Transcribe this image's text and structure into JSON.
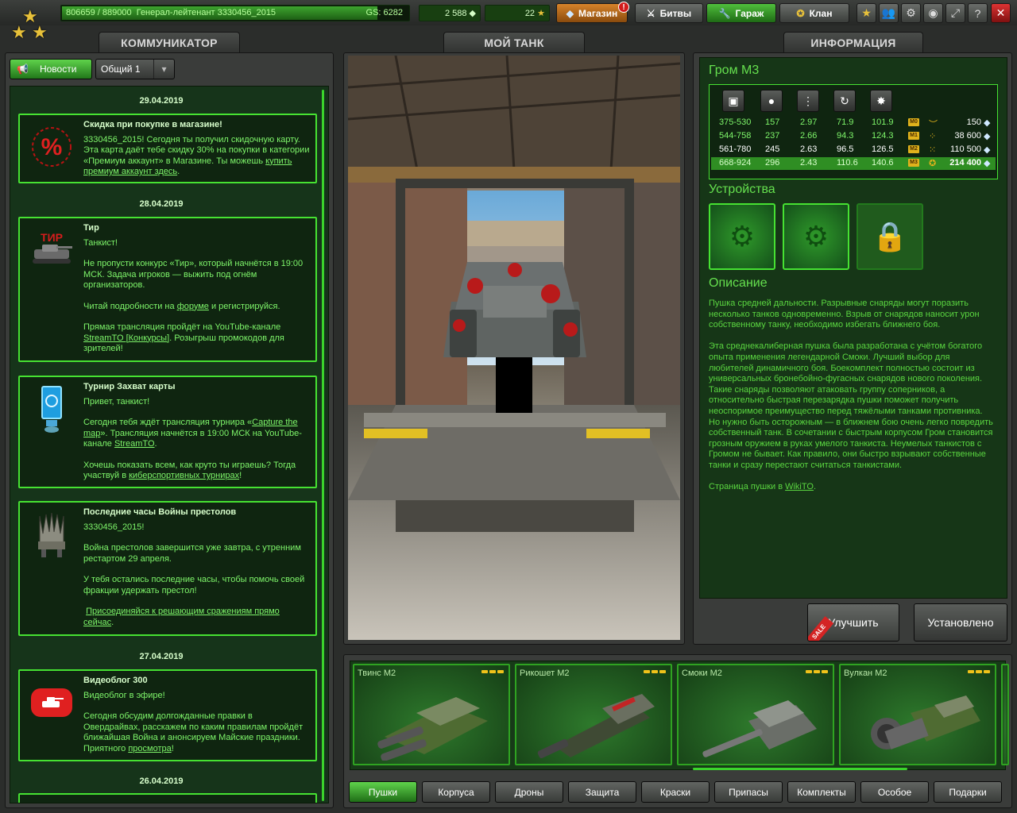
{
  "top": {
    "rank_progress": "806659 / 889000",
    "rank_progress_fraction": 0.907,
    "rank_name": "Генерал-лейтенант 3330456_2015",
    "gs": "GS: 6282",
    "crystals": "2 588",
    "stars": "22",
    "shop_label": "Магазин",
    "shop_badge": "!",
    "battles_label": "Битвы",
    "garage_label": "Гараж",
    "clan_label": "Клан"
  },
  "tabs": {
    "communicator": "КОММУНИКАТОР",
    "my_tank": "МОЙ ТАНК",
    "info": "ИНФОРМАЦИЯ"
  },
  "communicator": {
    "news_button": "Новости",
    "channel_select": "Общий 1",
    "feed": [
      {
        "type": "date",
        "text": "29.04.2019"
      },
      {
        "type": "card",
        "icon": "discount-percent-icon",
        "title": "Скидка при покупке в магазине!",
        "body": "3330456_2015! Сегодня ты получил скидочную карту. Эта карта даёт тебе скидку 30% на покупки в категории «Премиум аккаунт» в Магазине. Ты можешь ",
        "link": "купить премиум аккаунт здесь",
        "tail": "."
      },
      {
        "type": "date",
        "text": "28.04.2019"
      },
      {
        "type": "card",
        "icon": "shooting-range-icon",
        "title": "Тир",
        "p1": "Танкист!",
        "p2a": "Не пропусти конкурс «Тир», который начнётся в 19:00 МСК. Задача игроков — выжить под огнём организаторов.",
        "p3a": "Читай подробности на ",
        "p3link": "форуме",
        "p3b": " и регистрируйся.",
        "p4a": "Прямая трансляция пройдёт на YouTube-канале ",
        "p4link": "StreamTO [Конкурсы]",
        "p4b": ". Розыгрыш промокодов для зрителей!"
      },
      {
        "type": "card",
        "icon": "capture-flag-icon",
        "title": "Турнир Захват карты",
        "p1": "Привет, танкист!",
        "p2a": " Сегодня тебя ждёт трансляция турнира «",
        "p2link": "Capture the map",
        "p2b": "». Трансляция начнётся в 19:00 МСК на YouTube-канале ",
        "p2link2": "StreamTO",
        "p2c": ".",
        "p3a": "Хочешь показать всем, как круто ты играешь? Тогда участвуй в ",
        "p3link": "киберспортивных турнирах",
        "p3b": "!"
      },
      {
        "type": "card",
        "icon": "iron-throne-icon",
        "title": "Последние часы Войны престолов",
        "p1": "3330456_2015!",
        "p2": "Война престолов завершится уже завтра, с утренним рестартом 29 апреля.",
        "p3": "У тебя остались последние часы, чтобы помочь своей фракции удержать престол!",
        "p4link": "Присоединяйся к решающим сражениям прямо сейчас",
        "p4b": "."
      },
      {
        "type": "date",
        "text": "27.04.2019"
      },
      {
        "type": "card",
        "icon": "videoblog-icon",
        "title": "Видеоблог 300",
        "p1": "Видеоблог в эфире!",
        "p2a": "Сегодня обсудим долгожданные правки в Овердрайвах, расскажем по каким правилам пройдёт ближайшая Война и анонсируем Майские праздники. Приятного ",
        "p2link": "просмотра",
        "p2b": "!"
      },
      {
        "type": "date",
        "text": "26.04.2019"
      }
    ]
  },
  "item": {
    "name": "Гром M3",
    "stat_icons": [
      "damage-icon",
      "impact-force-icon",
      "reload-icon",
      "turret-rotation-icon",
      "splash-radius-icon"
    ],
    "rows": [
      {
        "damage": "375-530",
        "impact": "157",
        "reload": "2.97",
        "rotation": "71.9",
        "radius": "101.9",
        "mod": "M0",
        "rank_icon": "rank-chevron-icon",
        "price": "150",
        "selected": false
      },
      {
        "damage": "544-758",
        "impact": "237",
        "reload": "2.66",
        "rotation": "94.3",
        "radius": "124.3",
        "mod": "M1",
        "rank_icon": "rank-squares-icon",
        "price": "38 600",
        "selected": false
      },
      {
        "damage": "561-780",
        "impact": "245",
        "reload": "2.63",
        "rotation": "96.5",
        "radius": "126.5",
        "mod": "M2",
        "rank_icon": "rank-dots-icon",
        "price": "110 500",
        "selected": false
      },
      {
        "damage": "668-924",
        "impact": "296",
        "reload": "2.43",
        "rotation": "110.6",
        "radius": "140.6",
        "mod": "M3",
        "rank_icon": "rank-star-icon",
        "price": "214 400",
        "selected": true
      }
    ],
    "devices_heading": "Устройства",
    "devices": [
      {
        "icon": "device-gear-grid-icon",
        "locked": false
      },
      {
        "icon": "device-gear-cube-icon",
        "locked": false
      },
      {
        "icon": "lock-icon",
        "locked": true
      }
    ],
    "description_heading": "Описание",
    "desc_p1": "Пушка средней дальности. Разрывные снаряды могут поразить несколько танков одновременно. Взрыв от снарядов наносит урон собственному танку, необходимо избегать ближнего боя.",
    "desc_p2": "Эта среднекалиберная пушка была разработана с учётом богатого опыта применения легендарной Смоки. Лучший выбор для любителей динамичного боя. Боекомплект полностью состоит из универсальных бронебойно-фугасных снарядов нового поколения. Такие снаряды позволяют атаковать группу соперников, а относительно быстрая перезарядка пушки поможет получить неоспоримое преимущество перед тяжёлыми танками противника. Но нужно быть осторожным — в ближнем бою очень легко повредить собственный танк. В сочетании с быстрым корпусом Гром становится грозным оружием в руках умелого танкиста. Неумелых танкистов с Громом не бывает. Как правило, они быстро взрывают собственные танки и сразу перестают считаться танкистами.",
    "desc_p3a": "Страница пушки в ",
    "desc_p3link": "WikiTO",
    "desc_p3b": ".",
    "upgrade_label": "Улучшить",
    "sale_label": "SALE",
    "installed_label": "Установлено"
  },
  "items": [
    {
      "name": "Твинс M2",
      "level": 2
    },
    {
      "name": "Рикошет M2",
      "level": 2
    },
    {
      "name": "Смоки M2",
      "level": 2
    },
    {
      "name": "Вулкан M2",
      "level": 2
    }
  ],
  "categories": [
    "Пушки",
    "Корпуса",
    "Дроны",
    "Защита",
    "Краски",
    "Припасы",
    "Комплекты",
    "Особое",
    "Подарки"
  ],
  "active_category": "Пушки"
}
